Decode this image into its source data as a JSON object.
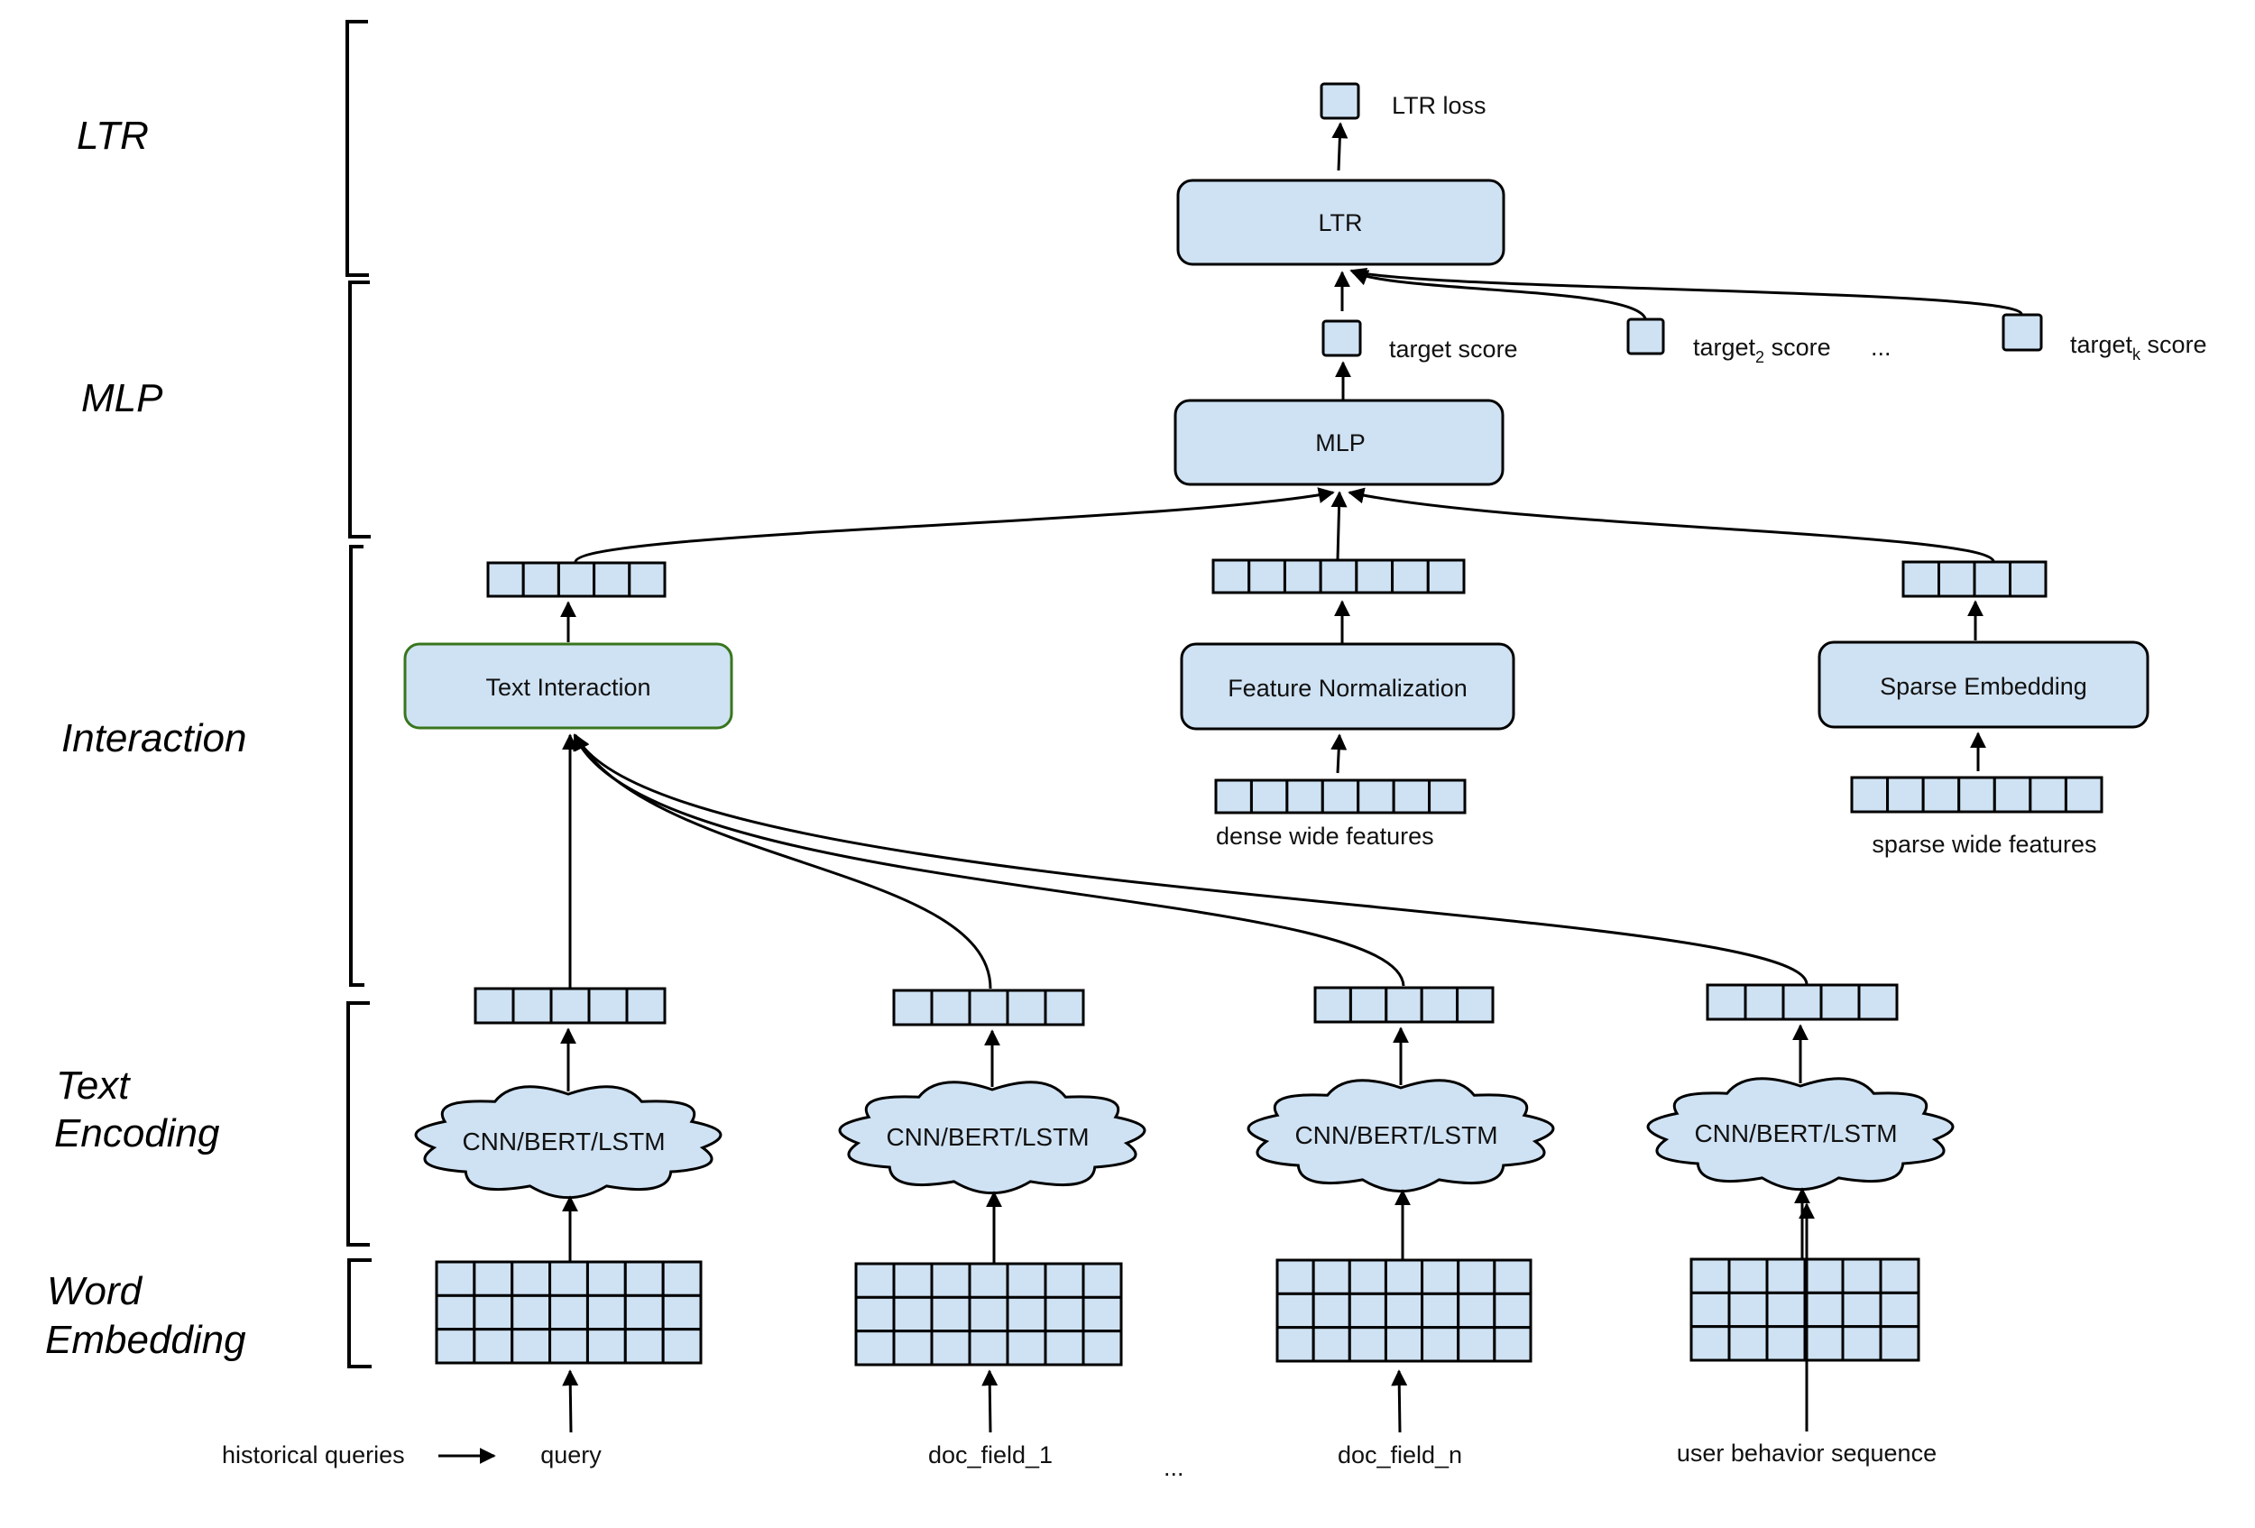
{
  "colors": {
    "fill": "#cfe2f3",
    "stroke": "#000000",
    "text_interaction_border": "#38761d"
  },
  "layers": [
    {
      "id": "ltr",
      "label_lines": [
        "LTR"
      ]
    },
    {
      "id": "mlp",
      "label_lines": [
        "MLP"
      ]
    },
    {
      "id": "interaction",
      "label_lines": [
        "Interaction"
      ]
    },
    {
      "id": "text_encoding",
      "label_lines": [
        "Text",
        "Encoding"
      ]
    },
    {
      "id": "word_embedding",
      "label_lines": [
        "Word",
        "Embedding"
      ]
    }
  ],
  "ltr": {
    "box_label": "LTR",
    "output_label": "LTR loss"
  },
  "targets": {
    "items": [
      {
        "base": "target",
        "sub": "",
        "suffix": " score"
      },
      {
        "base": "target",
        "sub": "2",
        "suffix": " score"
      },
      {
        "base": "target",
        "sub": "k",
        "suffix": " score"
      }
    ],
    "ellipsis": "..."
  },
  "mlp": {
    "box_label": "MLP"
  },
  "interaction": {
    "text_interaction": {
      "label": "Text Interaction",
      "output_cells": 5
    },
    "feature_normalization": {
      "label": "Feature Normalization",
      "output_cells": 7,
      "input_cells": 7,
      "input_label": "dense wide features"
    },
    "sparse_embedding": {
      "label": "Sparse Embedding",
      "output_cells": 4,
      "input_cells": 7,
      "input_label": "sparse wide features"
    }
  },
  "encoders": [
    {
      "id": "query",
      "encoder_label": "CNN/BERT/LSTM",
      "vector_cells": 5,
      "embedding_cols": 7,
      "embedding_rows": 3,
      "input_label": "query"
    },
    {
      "id": "doc_field_1",
      "encoder_label": "CNN/BERT/LSTM",
      "vector_cells": 5,
      "embedding_cols": 7,
      "embedding_rows": 3,
      "input_label": "doc_field_1"
    },
    {
      "id": "doc_field_n",
      "encoder_label": "CNN/BERT/LSTM",
      "vector_cells": 5,
      "embedding_cols": 7,
      "embedding_rows": 3,
      "input_label": "doc_field_n"
    },
    {
      "id": "user_behavior",
      "encoder_label": "CNN/BERT/LSTM",
      "vector_cells": 5,
      "embedding_cols": 6,
      "embedding_rows": 3,
      "input_label": "user behavior sequence"
    }
  ],
  "inputs": {
    "historical_label": "historical queries",
    "ellipsis": "..."
  }
}
